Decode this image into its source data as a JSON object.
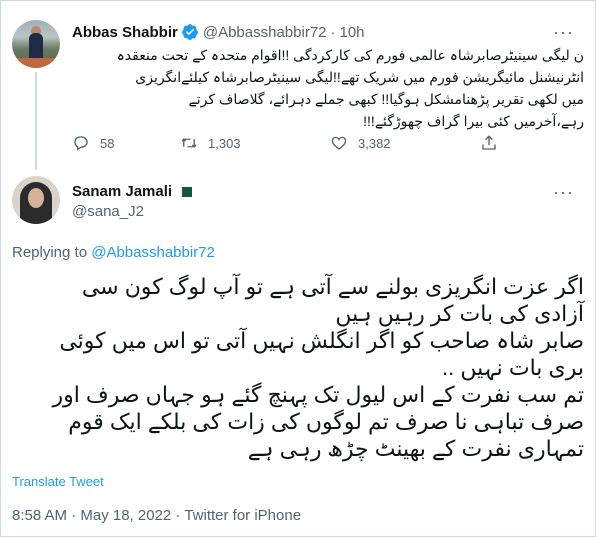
{
  "colors": {
    "accent": "#1d9bf0",
    "muted": "#536471",
    "text": "#0f1419",
    "border": "#cfd9de"
  },
  "parent_tweet": {
    "author_name": "Abbas Shabbir",
    "author_handle": "@Abbasshabbir72",
    "time": "10h",
    "more_icon": "more-horizontal-icon",
    "lines": [
      "ن لیگی سینیٹرصابرشاہ عالمی فورم کی کارکردگی !!اقوام متحدہ کے تحت منعقدہ",
      "انٹرنیشنل مائیگریشن فورم میں شریک تھے!!لیگی سینیٹرصابرشاہ کیلئےانگریزی",
      "میں لکھی تقریر پڑھنامشکل ہوگیا!! کبھی جملے دہرائے، گلاصاف کرتے",
      "رہے،آخرمیں کئی بیرا گراف چھوڑگئے!!!"
    ],
    "stats": {
      "replies": "58",
      "retweets": "1,303",
      "likes": "3,382"
    }
  },
  "reply_tweet": {
    "author_name": "Sanam Jamali",
    "author_handle": "@sana_J2",
    "replying_prefix": "Replying to ",
    "replying_to": "@Abbasshabbir72",
    "lines": [
      "اگر عزت انگریزی بولنے سے آتی ہے تو آپ لوگ کون سی",
      "آزادی کی بات کر رہیں ہیں",
      "صابر شاہ صاحب کو اگر انگلش نہیں آتی تو اس میں کوئی",
      "بری بات نہیں ..",
      "تم سب نفرت کے اس لیول تک پہنچ گئے ہو جہاں صرف اور",
      "صرف تباہی نا صرف تم لوگوں کی زات کی بلکے ایک قوم",
      "تمہاری نفرت کے بھینٹ چڑھ رہی ہے"
    ],
    "translate_label": "Translate Tweet",
    "timestamp": "8:58 AM · May 18, 2022 · Twitter for iPhone"
  }
}
